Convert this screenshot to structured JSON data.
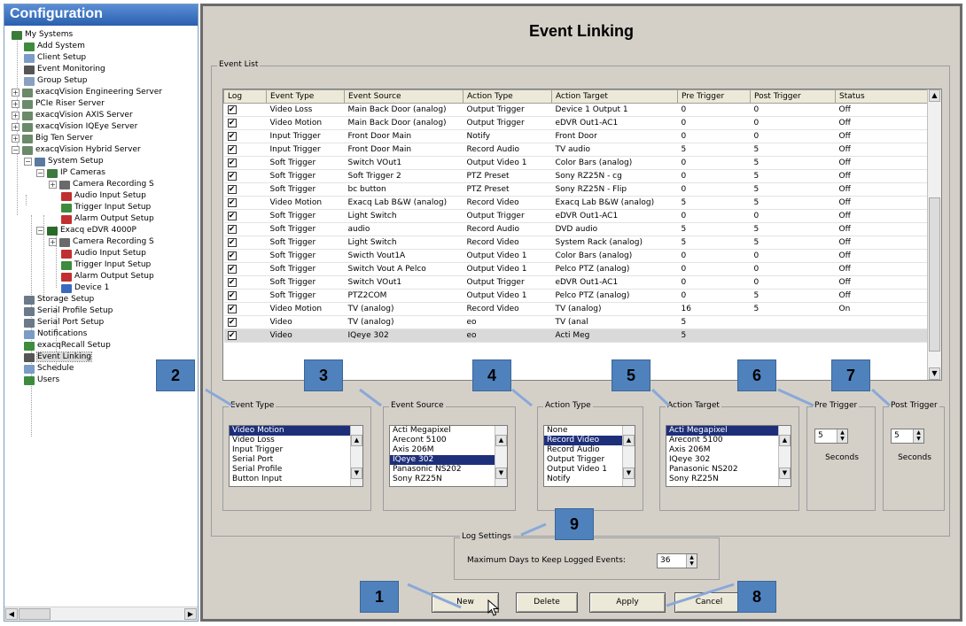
{
  "left_pane": {
    "title": "Configuration",
    "tree": [
      {
        "label": "My Systems",
        "icon": "systems-icon",
        "color": "#3a7a3a"
      },
      {
        "label": "Add System",
        "icon": "add-system-icon",
        "color": "#3d8b3d"
      },
      {
        "label": "Client Setup",
        "icon": "client-icon",
        "color": "#7a9cc6"
      },
      {
        "label": "Event Monitoring",
        "icon": "link-icon",
        "color": "#555555"
      },
      {
        "label": "Group Setup",
        "icon": "group-icon",
        "color": "#8aa0c0"
      },
      {
        "label": "exacqVision Engineering Server",
        "icon": "server-icon",
        "color": "#6a8a6a"
      },
      {
        "label": "PCIe Riser Server",
        "icon": "server-icon",
        "color": "#6a8a6a"
      },
      {
        "label": "exacqVision AXIS Server",
        "icon": "server-icon",
        "color": "#6a8a6a"
      },
      {
        "label": "exacqVision IQEye Server",
        "icon": "server-icon",
        "color": "#6a8a6a"
      },
      {
        "label": "Big Ten Server",
        "icon": "server-icon",
        "color": "#6a8a6a"
      },
      {
        "label": "exacqVision Hybrid Server",
        "icon": "server-icon",
        "color": "#6a8a6a"
      },
      {
        "label": "System Setup",
        "icon": "setup-icon",
        "color": "#5a7aa0"
      },
      {
        "label": "IP Cameras",
        "icon": "ip-camera-icon",
        "color": "#3d7a3d"
      },
      {
        "label": "Camera Recording S",
        "icon": "camera-icon",
        "color": "#6a6a6a"
      },
      {
        "label": "Audio Input Setup",
        "icon": "audio-icon",
        "color": "#c03030"
      },
      {
        "label": "Trigger Input Setup",
        "icon": "trigger-icon",
        "color": "#3d8b3d"
      },
      {
        "label": "Alarm Output Setup",
        "icon": "alarm-icon",
        "color": "#c03030"
      },
      {
        "label": "Exacq eDVR 4000P",
        "icon": "edvr-icon",
        "color": "#2a6a2a"
      },
      {
        "label": "Camera Recording S",
        "icon": "camera-icon",
        "color": "#6a6a6a"
      },
      {
        "label": "Audio Input Setup",
        "icon": "audio-icon",
        "color": "#c03030"
      },
      {
        "label": "Trigger Input Setup",
        "icon": "trigger-icon",
        "color": "#3d8b3d"
      },
      {
        "label": "Alarm Output Setup",
        "icon": "alarm-icon",
        "color": "#c03030"
      },
      {
        "label": "Device 1",
        "icon": "device-icon",
        "color": "#3a6ac0"
      },
      {
        "label": "Storage Setup",
        "icon": "storage-icon",
        "color": "#6a7a8a"
      },
      {
        "label": "Serial Profile Setup",
        "icon": "serial-profile-icon",
        "color": "#6a7a8a"
      },
      {
        "label": "Serial Port Setup",
        "icon": "serial-port-icon",
        "color": "#6a7a8a"
      },
      {
        "label": "Notifications",
        "icon": "notifications-icon",
        "color": "#7a9cc6"
      },
      {
        "label": "exacqRecall Setup",
        "icon": "recall-icon",
        "color": "#3d8b3d"
      },
      {
        "label": "Event Linking",
        "icon": "link-icon",
        "color": "#555555"
      },
      {
        "label": "Schedule",
        "icon": "schedule-icon",
        "color": "#7a9cc6"
      },
      {
        "label": "Users",
        "icon": "users-icon",
        "color": "#3d8b3d"
      }
    ]
  },
  "main": {
    "title": "Event Linking",
    "event_list": {
      "legend": "Event List",
      "columns": [
        "Log",
        "Event Type",
        "Event Source",
        "Action Type",
        "Action Target",
        "Pre Trigger",
        "Post Trigger",
        "Status"
      ],
      "rows": [
        {
          "log": "✔",
          "event_type": "Video Loss",
          "event_source": "Main Back Door (analog)",
          "action_type": "Output Trigger",
          "action_target": "Device 1 Output 1",
          "pre": "0",
          "post": "0",
          "status": "Off"
        },
        {
          "log": "✔",
          "event_type": "Video Motion",
          "event_source": "Main Back Door (analog)",
          "action_type": "Output Trigger",
          "action_target": "eDVR Out1-AC1",
          "pre": "0",
          "post": "0",
          "status": "Off"
        },
        {
          "log": "✔",
          "event_type": "Input Trigger",
          "event_source": "Front Door Main",
          "action_type": "Notify",
          "action_target": "Front Door",
          "pre": "0",
          "post": "0",
          "status": "Off"
        },
        {
          "log": "✔",
          "event_type": "Input Trigger",
          "event_source": "Front Door Main",
          "action_type": "Record Audio",
          "action_target": "TV audio",
          "pre": "5",
          "post": "5",
          "status": "Off"
        },
        {
          "log": "✔",
          "event_type": "Soft Trigger",
          "event_source": "Switch VOut1",
          "action_type": "Output Video 1",
          "action_target": "Color Bars (analog)",
          "pre": "0",
          "post": "5",
          "status": "Off"
        },
        {
          "log": "✔",
          "event_type": "Soft Trigger",
          "event_source": "Soft Trigger 2",
          "action_type": "PTZ Preset",
          "action_target": "Sony RZ25N - cg",
          "pre": "0",
          "post": "5",
          "status": "Off"
        },
        {
          "log": "✔",
          "event_type": "Soft Trigger",
          "event_source": "bc button",
          "action_type": "PTZ Preset",
          "action_target": "Sony RZ25N - Flip",
          "pre": "0",
          "post": "5",
          "status": "Off"
        },
        {
          "log": "✔",
          "event_type": "Video Motion",
          "event_source": "Exacq Lab B&W (analog)",
          "action_type": "Record Video",
          "action_target": "Exacq Lab B&W (analog)",
          "pre": "5",
          "post": "5",
          "status": "Off"
        },
        {
          "log": "✔",
          "event_type": "Soft Trigger",
          "event_source": "Light Switch",
          "action_type": "Output Trigger",
          "action_target": "eDVR Out1-AC1",
          "pre": "0",
          "post": "0",
          "status": "Off"
        },
        {
          "log": "✔",
          "event_type": "Soft Trigger",
          "event_source": "audio",
          "action_type": "Record Audio",
          "action_target": "DVD audio",
          "pre": "5",
          "post": "5",
          "status": "Off"
        },
        {
          "log": "✔",
          "event_type": "Soft Trigger",
          "event_source": "Light Switch",
          "action_type": "Record Video",
          "action_target": "System Rack (analog)",
          "pre": "5",
          "post": "5",
          "status": "Off"
        },
        {
          "log": "✔",
          "event_type": "Soft Trigger",
          "event_source": "Swicth Vout1A",
          "action_type": "Output Video 1",
          "action_target": "Color Bars (analog)",
          "pre": "0",
          "post": "0",
          "status": "Off"
        },
        {
          "log": "✔",
          "event_type": "Soft Trigger",
          "event_source": "Switch Vout A Pelco",
          "action_type": "Output Video 1",
          "action_target": "Pelco PTZ (analog)",
          "pre": "0",
          "post": "0",
          "status": "Off"
        },
        {
          "log": "✔",
          "event_type": "Soft Trigger",
          "event_source": "Switch VOut1",
          "action_type": "Output Trigger",
          "action_target": "eDVR Out1-AC1",
          "pre": "0",
          "post": "0",
          "status": "Off"
        },
        {
          "log": "✔",
          "event_type": "Soft Trigger",
          "event_source": "PTZ2COM",
          "action_type": "Output Video 1",
          "action_target": "Pelco PTZ (analog)",
          "pre": "0",
          "post": "5",
          "status": "Off"
        },
        {
          "log": "✔",
          "event_type": "Video Motion",
          "event_source": "TV (analog)",
          "action_type": "Record Video",
          "action_target": "TV (analog)",
          "pre": "16",
          "post": "5",
          "status": "On"
        },
        {
          "log": "✔",
          "event_type": "Video",
          "event_source": "TV (analog)",
          "action_type": "eo",
          "action_target": "TV (anal",
          "pre": "5",
          "post": "",
          "status": ""
        },
        {
          "log": "✔",
          "event_type": "Video",
          "event_source": "IQeye 302",
          "action_type": "eo",
          "action_target": "Acti Meg",
          "pre": "5",
          "post": "",
          "status": ""
        }
      ]
    },
    "selectors": {
      "event_type": {
        "legend": "Event Type",
        "options": [
          "Video Motion",
          "Video Loss",
          "Input Trigger",
          "Serial Port",
          "Serial Profile",
          "Button Input"
        ],
        "selected": "Video Motion"
      },
      "event_source": {
        "legend": "Event Source",
        "options": [
          "Acti Megapixel",
          "Arecont 5100",
          "Axis 206M",
          "IQeye 302",
          "Panasonic NS202",
          "Sony RZ25N"
        ],
        "selected": "IQeye 302"
      },
      "action_type": {
        "legend": "Action Type",
        "options": [
          "None",
          "Record Video",
          "Record Audio",
          "Output Trigger",
          "Output Video 1",
          "Notify"
        ],
        "selected": "Record Video"
      },
      "action_target": {
        "legend": "Action Target",
        "options": [
          "Acti Megapixel",
          "Arecont 5100",
          "Axis 206M",
          "IQeye 302",
          "Panasonic NS202",
          "Sony RZ25N"
        ],
        "selected": "Acti Megapixel"
      },
      "pre_trigger": {
        "legend": "Pre Trigger",
        "value": "5",
        "unit": "Seconds"
      },
      "post_trigger": {
        "legend": "Post Trigger",
        "value": "5",
        "unit": "Seconds"
      }
    },
    "log_settings": {
      "legend": "Log Settings",
      "label": "Maximum Days to Keep Logged Events:",
      "value": "36"
    },
    "buttons": {
      "new": "New",
      "delete": "Delete",
      "apply": "Apply",
      "cancel": "Cancel"
    }
  },
  "callouts": [
    "1",
    "2",
    "3",
    "4",
    "5",
    "6",
    "7",
    "8",
    "9"
  ],
  "colors": {
    "callout_fill": "#4f81bd",
    "list_selection": "#1e2f7a",
    "header_blue": "#2a5fae",
    "panel_gray": "#d4d0c8"
  }
}
